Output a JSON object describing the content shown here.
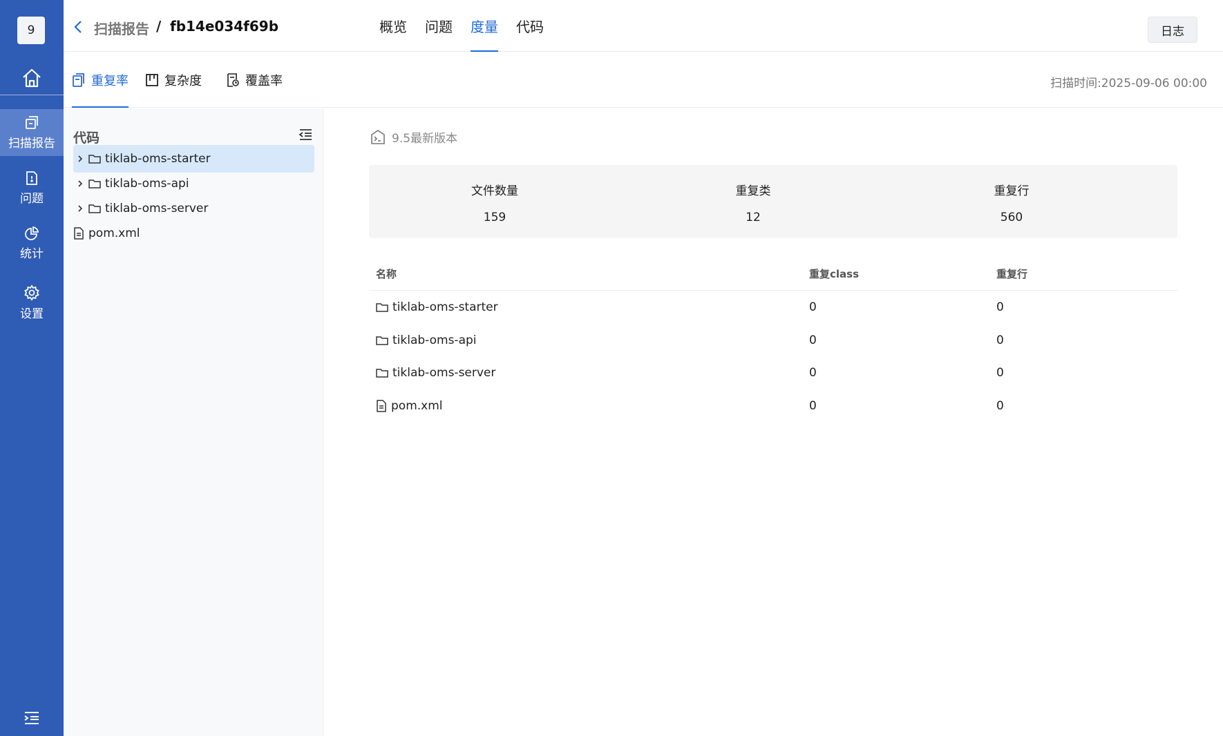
{
  "nav": {
    "badge": "9",
    "items": [
      {
        "label": "扫描报告",
        "icon": "report-icon"
      },
      {
        "label": "问题",
        "icon": "issue-icon"
      },
      {
        "label": "统计",
        "icon": "pie-chart-icon"
      },
      {
        "label": "设置",
        "icon": "gear-icon"
      }
    ],
    "active": "扫描报告"
  },
  "header": {
    "breadcrumb_parent": "扫描报告",
    "breadcrumb_sep": "/",
    "breadcrumb_current": "fb14e034f69b",
    "tabs": [
      "概览",
      "问题",
      "度量",
      "代码"
    ],
    "active_tab": "度量",
    "log_button": "日志"
  },
  "subtabs": {
    "items": [
      "重复率",
      "复杂度",
      "覆盖率"
    ],
    "active": "重复率",
    "scan_time": "扫描时间:2025-09-06 00:00"
  },
  "tree": {
    "title": "代码",
    "items": [
      {
        "name": "tiklab-oms-starter",
        "type": "folder",
        "selected": true
      },
      {
        "name": "tiklab-oms-api",
        "type": "folder"
      },
      {
        "name": "tiklab-oms-server",
        "type": "folder"
      },
      {
        "name": "pom.xml",
        "type": "file"
      }
    ]
  },
  "main": {
    "version": "9.5最新版本",
    "stats": [
      {
        "label": "文件数量",
        "value": "159"
      },
      {
        "label": "重复类",
        "value": "12"
      },
      {
        "label": "重复行",
        "value": "560"
      }
    ],
    "table": {
      "headers": [
        "名称",
        "重复class",
        "重复行"
      ],
      "rows": [
        {
          "name": "tiklab-oms-starter",
          "type": "folder",
          "dup_class": "0",
          "dup_lines": "0"
        },
        {
          "name": "tiklab-oms-api",
          "type": "folder",
          "dup_class": "0",
          "dup_lines": "0"
        },
        {
          "name": "tiklab-oms-server",
          "type": "folder",
          "dup_class": "0",
          "dup_lines": "0"
        },
        {
          "name": "pom.xml",
          "type": "file",
          "dup_class": "0",
          "dup_lines": "0"
        }
      ]
    }
  },
  "colors": {
    "nav_bg": "#2f5cb5",
    "accent": "#1f6bd8",
    "selected_row": "#d7e8fb"
  }
}
